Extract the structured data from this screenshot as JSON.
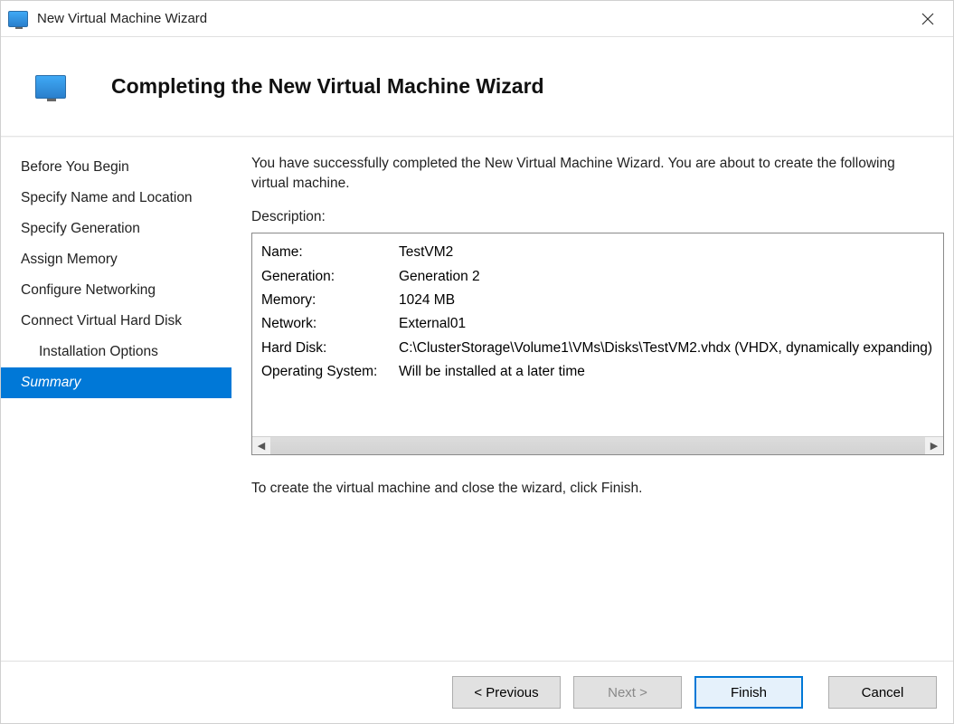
{
  "window": {
    "title": "New Virtual Machine Wizard"
  },
  "header": {
    "heading": "Completing the New Virtual Machine Wizard"
  },
  "sidebar": {
    "steps": [
      {
        "label": "Before You Begin"
      },
      {
        "label": "Specify Name and Location"
      },
      {
        "label": "Specify Generation"
      },
      {
        "label": "Assign Memory"
      },
      {
        "label": "Configure Networking"
      },
      {
        "label": "Connect Virtual Hard Disk"
      },
      {
        "label": "Installation Options"
      },
      {
        "label": "Summary"
      }
    ]
  },
  "content": {
    "intro": "You have successfully completed the New Virtual Machine Wizard. You are about to create the following virtual machine.",
    "description_label": "Description:",
    "rows": {
      "name_key": "Name:",
      "name_val": "TestVM2",
      "gen_key": "Generation:",
      "gen_val": "Generation 2",
      "mem_key": "Memory:",
      "mem_val": "1024 MB",
      "net_key": "Network:",
      "net_val": "External01",
      "hd_key": "Hard Disk:",
      "hd_val": "C:\\ClusterStorage\\Volume1\\VMs\\Disks\\TestVM2.vhdx (VHDX, dynamically expanding)",
      "os_key": "Operating System:",
      "os_val": "Will be installed at a later time"
    },
    "outro": "To create the virtual machine and close the wizard, click Finish."
  },
  "footer": {
    "previous": "< Previous",
    "next": "Next >",
    "finish": "Finish",
    "cancel": "Cancel"
  }
}
